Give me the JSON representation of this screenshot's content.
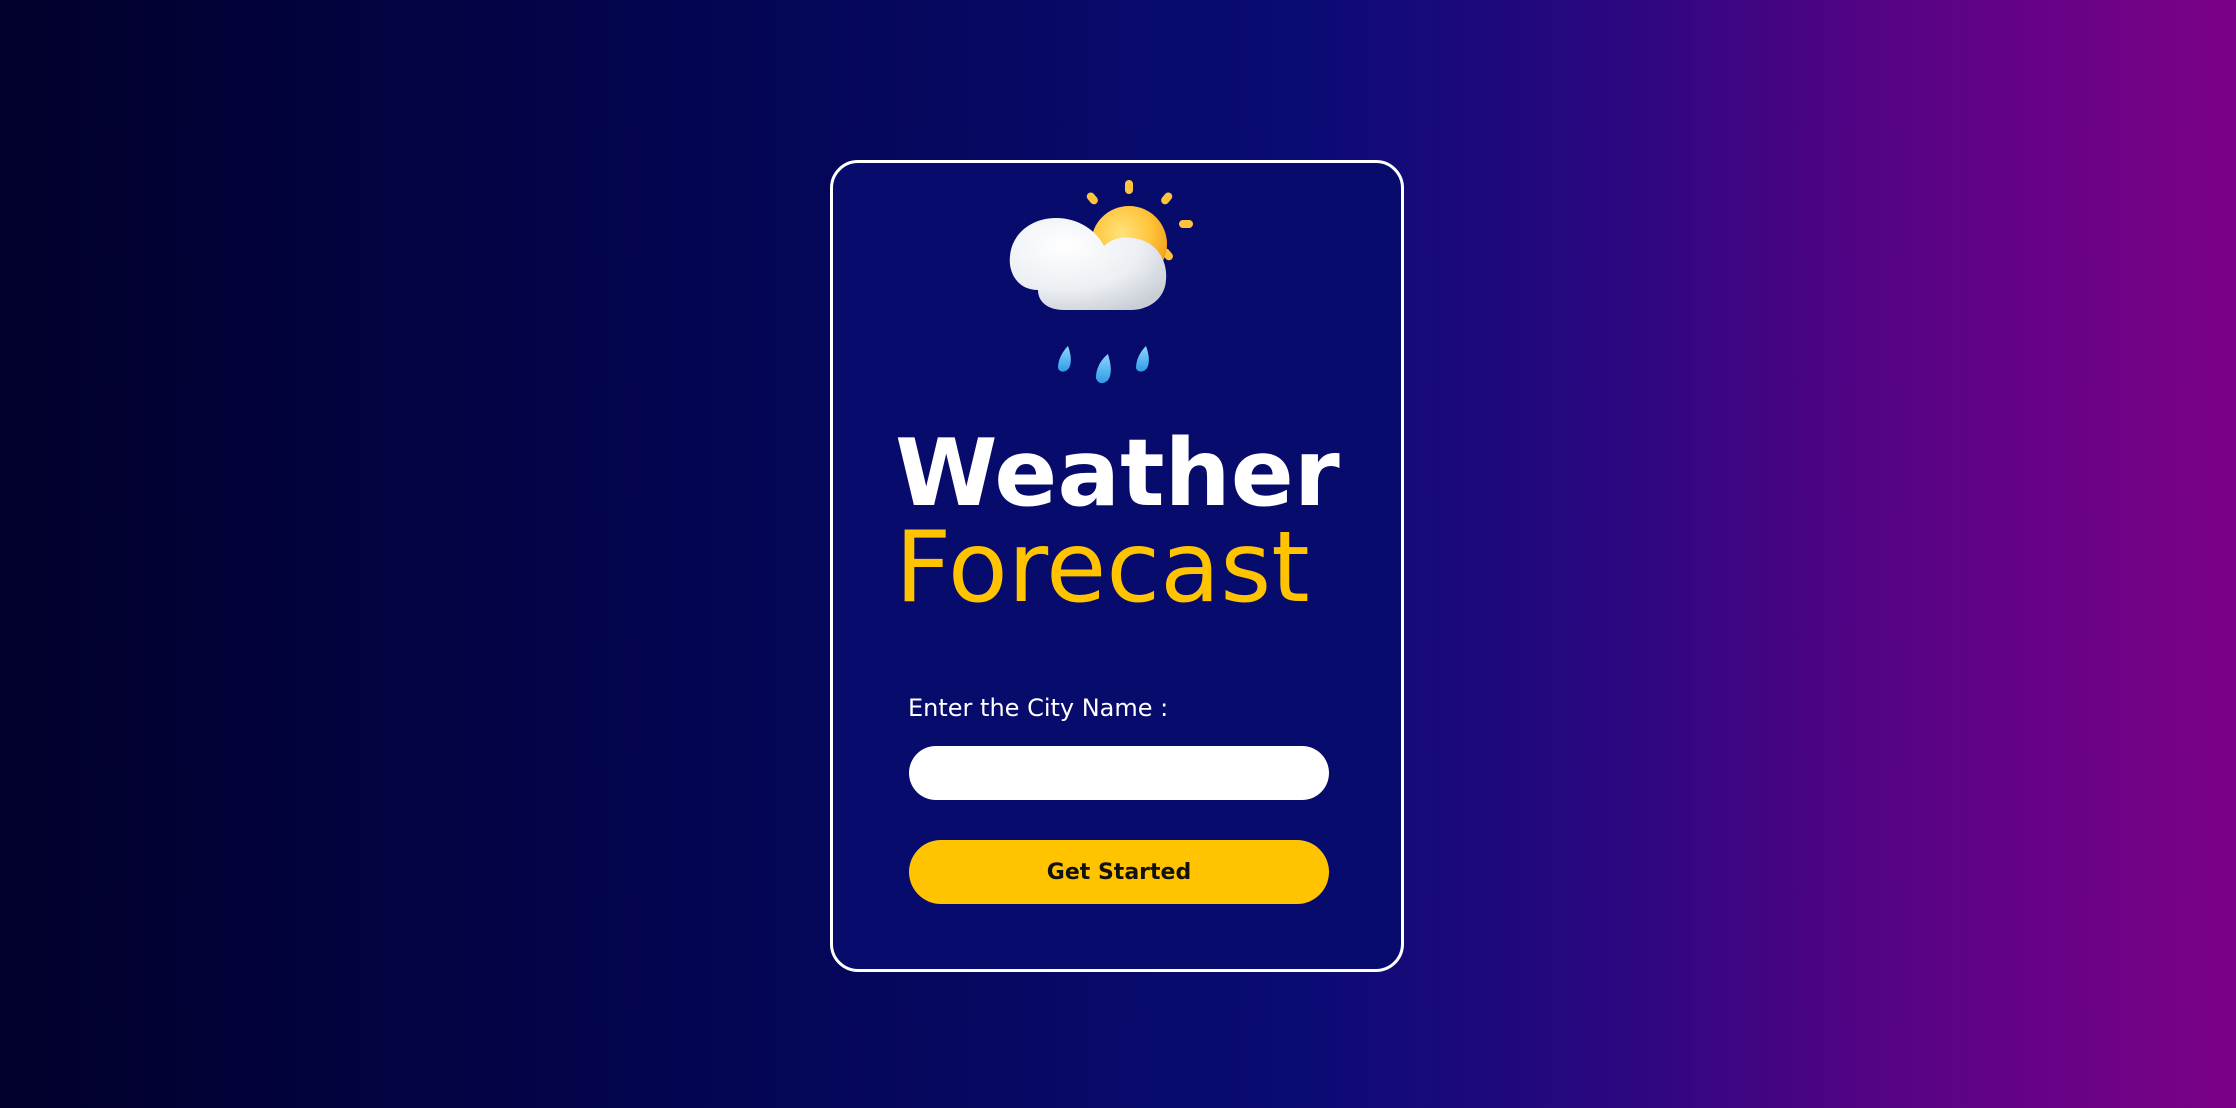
{
  "card": {
    "icon": "cloud-sun-rain-icon",
    "title_line_1": "Weather",
    "title_line_2": "Forecast",
    "city_label": "Enter the City Name :",
    "city_input_value": "",
    "city_input_placeholder": "",
    "button_label": "Get Started"
  },
  "colors": {
    "card_background": "#070b6b",
    "accent_yellow": "#ffc300",
    "white": "#ffffff",
    "gradient_left": "#01002b",
    "gradient_right": "#7b0187"
  }
}
